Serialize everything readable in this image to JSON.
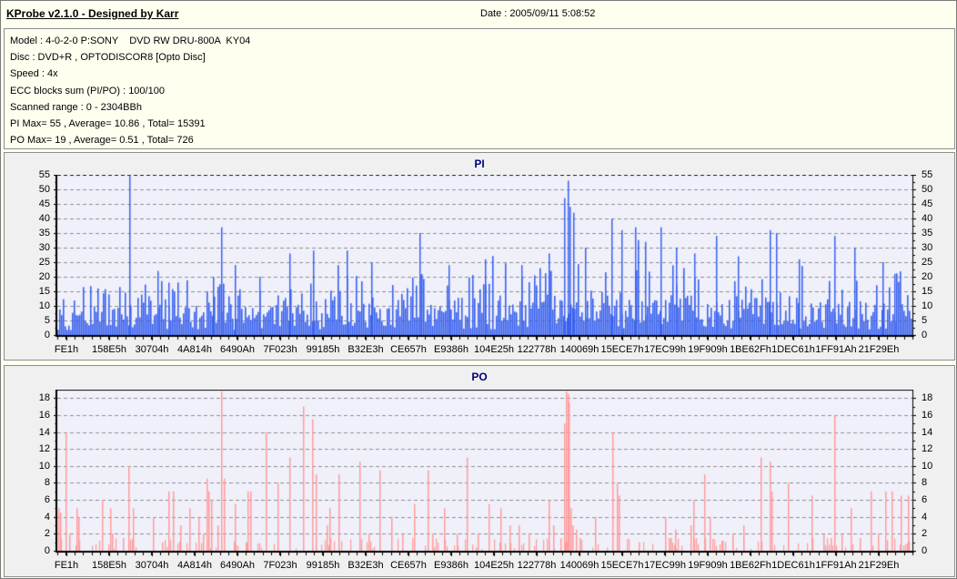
{
  "header": {
    "title": "KProbe v2.1.0 - Designed by Karr",
    "date": "Date : 2005/09/11 5:08:52"
  },
  "info": {
    "model": "Model : 4-0-2-0 P:SONY    DVD RW DRU-800A  KY04",
    "disc": "Disc : DVD+R , OPTODISCOR8 [Opto Disc]",
    "speed": "Speed : 4x",
    "ecc": "ECC blocks sum (PI/PO) : 100/100",
    "range": "Scanned range : 0 - 2304BBh",
    "pi_summary": "PI Max= 55 , Average= 10.86 , Total= 15391",
    "po_summary": "PO Max= 19 , Average= 0.51 , Total= 726"
  },
  "colors": {
    "pi_bar": "#3b63ee",
    "po_bar": "#ff9c9c",
    "plot_bg": "#f0f0fa",
    "grid": "#8f8f8f",
    "title_navy": "#000080",
    "panel_bg": "#f0f0f0",
    "window_bg": "#fffff0"
  },
  "chart_data": [
    {
      "id": "pi",
      "type": "bar",
      "title": "PI",
      "ylabel": "",
      "xlabel": "",
      "ylim": [
        0,
        55
      ],
      "ytick_step": 5,
      "grid": true,
      "legend_position": "none",
      "bar_color": "#3b63ee",
      "plot_bg": "#f0f0fa",
      "stats": {
        "max": 55,
        "average": 10.86,
        "total": 15391
      },
      "x_tick_labels": [
        "FE1h",
        "158E5h",
        "30704h",
        "4A814h",
        "6490Ah",
        "7F023h",
        "99185h",
        "B32E3h",
        "CE657h",
        "E9386h",
        "104E25h",
        "122778h",
        "140069h",
        "15ECE7h",
        "17EC99h",
        "19F909h",
        "1BE62Fh",
        "1DEC61h",
        "1FF91Ah",
        "21F29Eh"
      ],
      "noise": {
        "seed": 20050911,
        "count": 470,
        "base_min": 2,
        "base_max": 13,
        "mid_prob": 0.2,
        "mid_min": 13,
        "mid_max": 22,
        "high_prob": 0.018,
        "high_min": 23,
        "high_max": 32
      },
      "envelope": [
        0.85,
        0.8,
        0.85,
        0.9,
        0.85,
        0.9,
        0.95,
        0.9,
        0.95,
        1.0,
        1.0,
        1.05,
        1.2,
        1.15,
        1.1,
        1.05,
        1.0,
        1.0,
        0.95,
        1.0
      ],
      "peaks": [
        [
          79,
          55
        ],
        [
          110,
          22
        ],
        [
          122,
          18
        ],
        [
          171,
          20
        ],
        [
          180,
          37
        ],
        [
          195,
          24
        ],
        [
          222,
          20
        ],
        [
          255,
          28
        ],
        [
          281,
          29
        ],
        [
          318,
          29
        ],
        [
          345,
          25
        ],
        [
          398,
          35
        ],
        [
          430,
          24
        ],
        [
          470,
          26
        ],
        [
          510,
          24
        ],
        [
          540,
          28
        ],
        [
          557,
          47
        ],
        [
          561,
          53
        ],
        [
          563,
          44
        ],
        [
          567,
          42
        ],
        [
          580,
          30
        ],
        [
          609,
          40
        ],
        [
          620,
          36
        ],
        [
          635,
          37
        ],
        [
          646,
          32
        ],
        [
          663,
          37
        ],
        [
          680,
          30
        ],
        [
          700,
          28
        ],
        [
          724,
          34
        ],
        [
          748,
          27
        ],
        [
          783,
          36
        ],
        [
          790,
          35
        ],
        [
          815,
          26
        ],
        [
          854,
          34
        ],
        [
          876,
          30
        ],
        [
          907,
          25
        ],
        [
          920,
          21
        ]
      ]
    },
    {
      "id": "po",
      "type": "bar",
      "title": "PO",
      "ylabel": "",
      "xlabel": "",
      "ylim": [
        0,
        19
      ],
      "ytick_step": 2,
      "ytick_max": 18,
      "grid": true,
      "legend_position": "none",
      "bar_color": "#ff9c9c",
      "plot_bg": "#f0f0fa",
      "stats": {
        "max": 19,
        "average": 0.51,
        "total": 726
      },
      "x_tick_labels": [
        "FE1h",
        "158E5h",
        "30704h",
        "4A814h",
        "6490Ah",
        "7F023h",
        "99185h",
        "B32E3h",
        "CE657h",
        "E9386h",
        "104E25h",
        "122778h",
        "140069h",
        "15ECE7h",
        "17EC99h",
        "19F909h",
        "1BE62Fh",
        "1DEC61h",
        "1FF91Ah",
        "21F29Eh"
      ],
      "noise": {
        "seed": 726,
        "count": 470,
        "prob": 0.3,
        "max": 1.3
      },
      "bars": [
        [
          1,
          5
        ],
        [
          3,
          4.5
        ],
        [
          9,
          14
        ],
        [
          13,
          2
        ],
        [
          21,
          5
        ],
        [
          23,
          4
        ],
        [
          49,
          6
        ],
        [
          58,
          5
        ],
        [
          60,
          2
        ],
        [
          72,
          1.5
        ],
        [
          78,
          10
        ],
        [
          83,
          5
        ],
        [
          105,
          4
        ],
        [
          115,
          1
        ],
        [
          122,
          7
        ],
        [
          127,
          7
        ],
        [
          135,
          3
        ],
        [
          145,
          5
        ],
        [
          155,
          4
        ],
        [
          160,
          2
        ],
        [
          164,
          8.5
        ],
        [
          166,
          7
        ],
        [
          169,
          6
        ],
        [
          176,
          3
        ],
        [
          180,
          18.8
        ],
        [
          183,
          8.5
        ],
        [
          195,
          5.5
        ],
        [
          207,
          1
        ],
        [
          209,
          7
        ],
        [
          212,
          7
        ],
        [
          229,
          14
        ],
        [
          242,
          8
        ],
        [
          255,
          11
        ],
        [
          270,
          17
        ],
        [
          280,
          15.5
        ],
        [
          284,
          9
        ],
        [
          296,
          3
        ],
        [
          299,
          5
        ],
        [
          309,
          9
        ],
        [
          332,
          10.5
        ],
        [
          342,
          2
        ],
        [
          354,
          9.5
        ],
        [
          367,
          4
        ],
        [
          379,
          2
        ],
        [
          392,
          5.5
        ],
        [
          407,
          9.5
        ],
        [
          412,
          2
        ],
        [
          425,
          5
        ],
        [
          439,
          2
        ],
        [
          450,
          11
        ],
        [
          462,
          2
        ],
        [
          474,
          5.5
        ],
        [
          487,
          5
        ],
        [
          497,
          3
        ],
        [
          507,
          3
        ],
        [
          518,
          2
        ],
        [
          540,
          6
        ],
        [
          545,
          3
        ],
        [
          553,
          1.5
        ],
        [
          557,
          15
        ],
        [
          559,
          18.8
        ],
        [
          561,
          18.5
        ],
        [
          562,
          17.5
        ],
        [
          564,
          5
        ],
        [
          566,
          3
        ],
        [
          570,
          2.5
        ],
        [
          574,
          1.5
        ],
        [
          591,
          4
        ],
        [
          610,
          14
        ],
        [
          615,
          8
        ],
        [
          617,
          6.5
        ],
        [
          639,
          1
        ],
        [
          668,
          4
        ],
        [
          672,
          1.5
        ],
        [
          674,
          1.5
        ],
        [
          679,
          2.5
        ],
        [
          696,
          3
        ],
        [
          699,
          6
        ],
        [
          711,
          9
        ],
        [
          717,
          4
        ],
        [
          731,
          1.2
        ],
        [
          742,
          2
        ],
        [
          754,
          3
        ],
        [
          773,
          11
        ],
        [
          783,
          10.5
        ],
        [
          785,
          7
        ],
        [
          803,
          8
        ],
        [
          829,
          6.5
        ],
        [
          842,
          2
        ],
        [
          850,
          1.5
        ],
        [
          854,
          16
        ],
        [
          862,
          2
        ],
        [
          872,
          5
        ],
        [
          882,
          1.5
        ],
        [
          894,
          7
        ],
        [
          902,
          2
        ],
        [
          910,
          7
        ],
        [
          917,
          7
        ],
        [
          927,
          6.5
        ],
        [
          935,
          6.5
        ]
      ]
    }
  ]
}
